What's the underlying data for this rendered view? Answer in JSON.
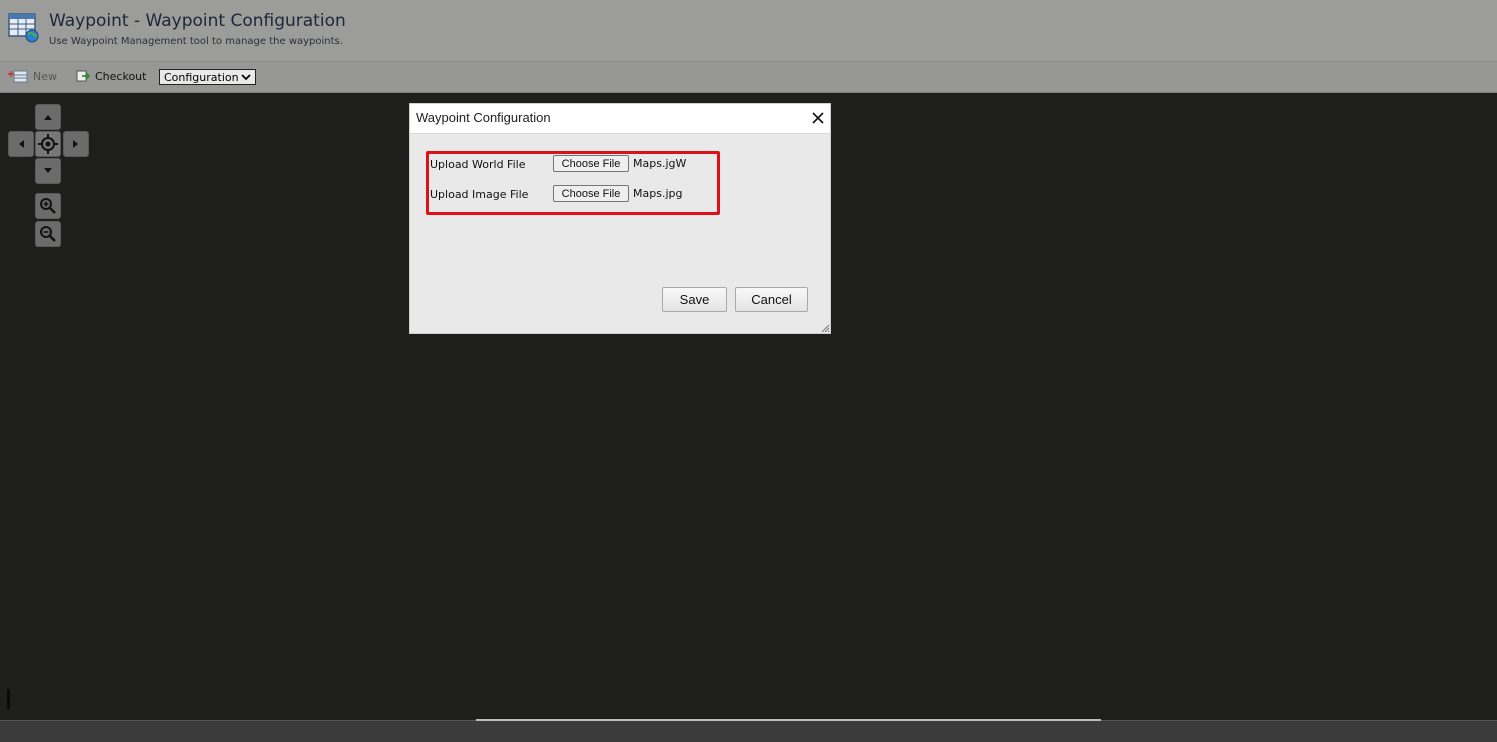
{
  "header": {
    "title": "Waypoint - Waypoint Configuration",
    "subtitle": "Use Waypoint Management tool to manage the waypoints.",
    "icon": "table-globe-icon"
  },
  "toolbar": {
    "new_label": "New",
    "checkout_label": "Checkout",
    "view_select": {
      "selected": "Configuration"
    }
  },
  "map_controls": {
    "pan_up": "pan-up-icon",
    "pan_down": "pan-down-icon",
    "pan_left": "pan-left-icon",
    "pan_right": "pan-right-icon",
    "center": "crosshair-icon",
    "zoom_in": "zoom-in-icon",
    "zoom_out": "zoom-out-icon"
  },
  "dialog": {
    "title": "Waypoint Configuration",
    "rows": [
      {
        "label": "Upload World File",
        "button": "Choose File",
        "file_name": "Maps.jgW"
      },
      {
        "label": "Upload Image File",
        "button": "Choose File",
        "file_name": "Maps.jpg"
      }
    ],
    "save_label": "Save",
    "cancel_label": "Cancel",
    "highlight_color": "#e0101a"
  }
}
